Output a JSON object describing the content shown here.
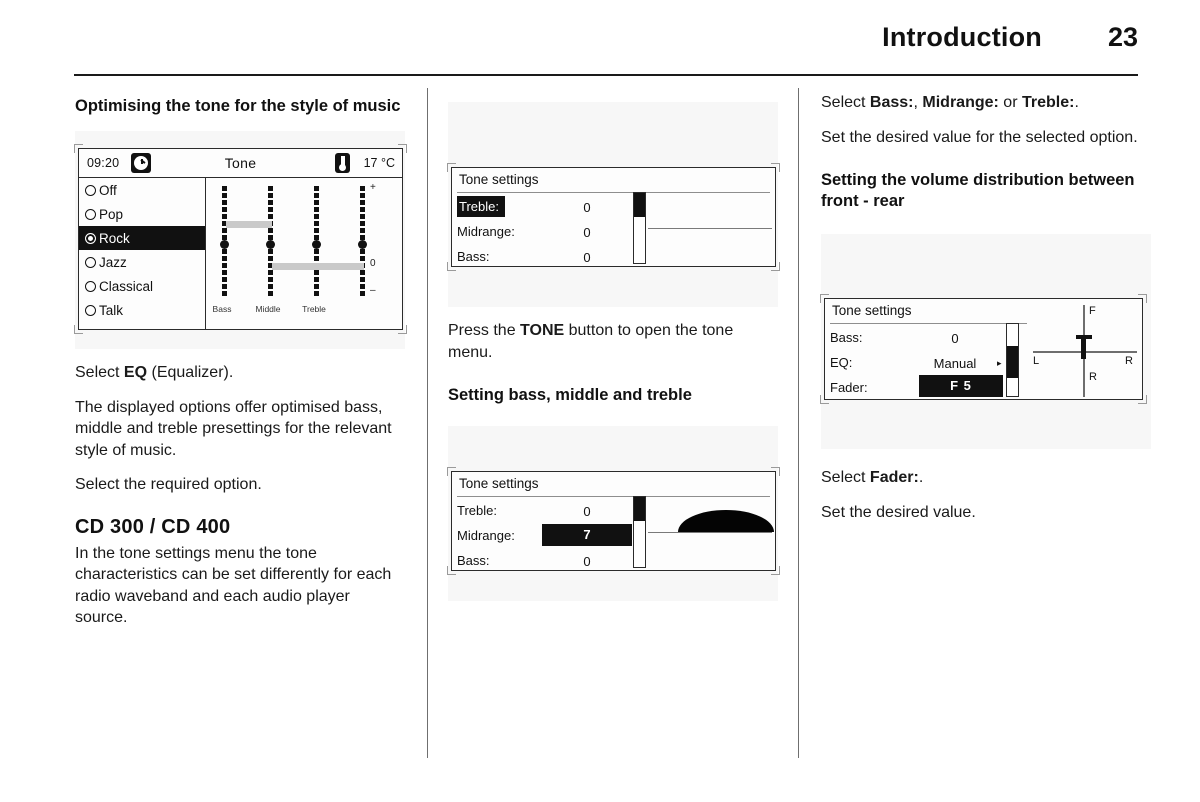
{
  "header": {
    "title": "Introduction",
    "page_number": "23"
  },
  "column_1": {
    "heading": "Optimising the tone for the style of music",
    "figure_tone_presets": {
      "status_bar": {
        "time": "09:20",
        "clock_icon": "clock-icon",
        "screen_title": "Tone",
        "temperature_icon": "thermometer-icon",
        "temperature": "17 °C"
      },
      "presets": [
        {
          "label": "Off",
          "selected": false
        },
        {
          "label": "Pop",
          "selected": false
        },
        {
          "label": "Rock",
          "selected": true
        },
        {
          "label": "Jazz",
          "selected": false
        },
        {
          "label": "Classical",
          "selected": false
        },
        {
          "label": "Talk",
          "selected": false
        }
      ],
      "eq_columns": [
        "Bass",
        "Middle",
        "Treble"
      ],
      "scale_marks": {
        "top": "+",
        "middle": "0",
        "bottom": "–"
      }
    },
    "para_select_eq_pre": "Select ",
    "para_select_eq_bold": "EQ",
    "para_select_eq_post": " (Equalizer).",
    "para_options": "The displayed options offer optimised bass, middle and treble presettings for the relevant style of music.",
    "para_required": "Select the required option.",
    "heading_cd": "CD 300 / CD 400",
    "para_cd": "In the tone settings menu the tone characteristics can be set differently for each radio waveband and each audio player source."
  },
  "column_2": {
    "figure_tone_settings_1": {
      "title": "Tone settings",
      "rows": [
        {
          "label": "Treble:",
          "value": "0",
          "label_highlighted": true,
          "value_highlighted": false
        },
        {
          "label": "Midrange:",
          "value": "0",
          "label_highlighted": false,
          "value_highlighted": false
        },
        {
          "label": "Bass:",
          "value": "0",
          "label_highlighted": false,
          "value_highlighted": false
        }
      ],
      "curve": "flat"
    },
    "para_press_pre": "Press the ",
    "para_press_bold": "TONE",
    "para_press_post": " button to open the tone menu.",
    "heading_setting": "Setting bass, middle and treble",
    "figure_tone_settings_2": {
      "title": "Tone settings",
      "rows": [
        {
          "label": "Treble:",
          "value": "0",
          "label_highlighted": false,
          "value_highlighted": false
        },
        {
          "label": "Midrange:",
          "value": "7",
          "label_highlighted": false,
          "value_highlighted": true
        },
        {
          "label": "Bass:",
          "value": "0",
          "label_highlighted": false,
          "value_highlighted": false
        }
      ],
      "curve": "midrange-boost"
    }
  },
  "column_3": {
    "para_select_pre": "Select ",
    "para_select_bass": "Bass:",
    "para_select_mid": "Midrange:",
    "para_select_treble": "Treble:",
    "para_select_or": " or ",
    "para_select_sep": ", ",
    "para_select_end": ".",
    "para_set_value": "Set the desired value for the selected option.",
    "heading_volume": "Setting the volume distribution between front - rear",
    "figure_fader": {
      "title": "Tone settings",
      "rows": [
        {
          "label": "Bass:",
          "value": "0",
          "label_highlighted": false,
          "value_highlighted": false,
          "chevron": false
        },
        {
          "label": "EQ:",
          "value": "Manual",
          "label_highlighted": false,
          "value_highlighted": false,
          "chevron": true
        },
        {
          "label": "Fader:",
          "value": "F 5",
          "label_highlighted": false,
          "value_highlighted": true,
          "chevron": false
        }
      ],
      "crosshair": {
        "front": "F",
        "rear": "R",
        "left": "L",
        "right": "R"
      }
    },
    "para_select_fader_pre": "Select ",
    "para_select_fader_bold": "Fader:",
    "para_select_fader_post": ".",
    "para_set_desired": "Set the desired value."
  }
}
